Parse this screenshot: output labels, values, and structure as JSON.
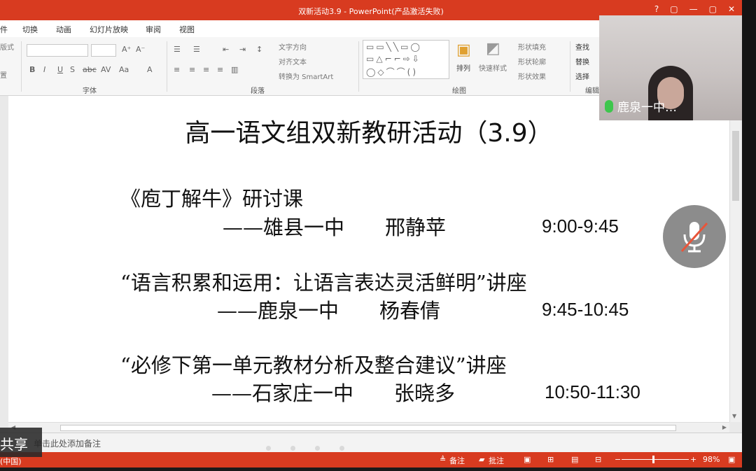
{
  "window": {
    "title": "双新活动3.9 - PowerPoint(产品激活失败)",
    "controls": [
      "?",
      "▢",
      "—",
      "▢",
      "✕"
    ]
  },
  "ribbon_tabs": [
    "件",
    "切换",
    "动画",
    "幻灯片放映",
    "审阅",
    "视图"
  ],
  "ribbon": {
    "font_group": "字体",
    "paragraph_group": "段落",
    "drawing_group": "绘图",
    "edit_group": "编辑",
    "left_cut_1": "版式",
    "left_cut_2": "置",
    "text_direction": "文字方向",
    "align_text": "对齐文本",
    "convert_smartart": "转换为 SmartArt",
    "arrange": "排列",
    "quick_styles": "快速样式",
    "shape_fill": "形状填充",
    "shape_outline": "形状轮廓",
    "shape_effects": "形状效果",
    "find": "查找",
    "replace": "替换",
    "select": "选择"
  },
  "slide": {
    "title": "高一语文组双新教研活动（3.9）",
    "items": [
      {
        "topic": "《庖丁解牛》研讨课",
        "presenter": "——雄县一中　　邢静苹",
        "time": "9:00-9:45"
      },
      {
        "topic": "“语言积累和运用：让语言表达灵活鲜明”讲座",
        "presenter": "——鹿泉一中　　杨春倩",
        "time": "9:45-10:45"
      },
      {
        "topic": "“必修下第一单元教材分析及整合建议”讲座",
        "presenter": "——石家庄一中　　张晓多",
        "time": "10:50-11:30"
      }
    ]
  },
  "notes_placeholder": "单击此处添加备注",
  "status": {
    "language": "(中国)",
    "notes_btn": "备注",
    "comments_btn": "批注",
    "zoom": "98%"
  },
  "share_label": "共享",
  "video": {
    "participant": "鹿泉一中…"
  },
  "colors": {
    "accent": "#d83b20",
    "mic_active": "#3ec64d"
  }
}
